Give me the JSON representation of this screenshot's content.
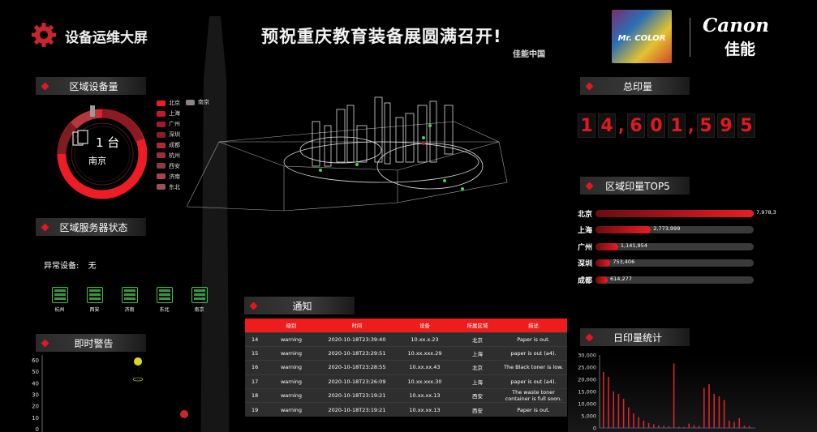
{
  "header": {
    "app_title": "设备运维大屏",
    "main_title": "预祝重庆教育装备展圆满召开!",
    "subtitle": "佳能中国",
    "brand_box_text": "Mr. COLOR",
    "brand_name": "Canon",
    "brand_name_cn": "佳能"
  },
  "region_devices": {
    "title": "区域设备量",
    "count_label": "1 台",
    "city": "南京",
    "legend": [
      {
        "name": "北京",
        "color": "#ee1c24"
      },
      {
        "name": "上海",
        "color": "#c8192a"
      },
      {
        "name": "广州",
        "color": "#a51a2b"
      },
      {
        "name": "深圳",
        "color": "#8e1c2a"
      },
      {
        "name": "成都",
        "color": "#b12a33"
      },
      {
        "name": "杭州",
        "color": "#9c2e37"
      },
      {
        "name": "西安",
        "color": "#8a3a40"
      },
      {
        "name": "济南",
        "color": "#a8444a"
      },
      {
        "name": "东北",
        "color": "#8f5558"
      }
    ],
    "legend_extra": {
      "name": "南京",
      "color": "#8d8282"
    }
  },
  "server_status": {
    "title": "区域服务器状态",
    "abnormal_label": "异常设备:",
    "abnormal_value": "无",
    "servers": [
      "杭州",
      "西安",
      "济南",
      "东北",
      "南京"
    ],
    "status_color": "#3cc24a"
  },
  "alerts": {
    "title": "即时警告",
    "y_ticks": [
      "60",
      "50",
      "40",
      "30",
      "20",
      "10",
      "0"
    ]
  },
  "total_prints": {
    "title": "总印量",
    "digits": [
      "1",
      "4",
      ",",
      "6",
      "0",
      "1",
      ",",
      "5",
      "9",
      "5"
    ]
  },
  "top5": {
    "title": "区域印量TOP5",
    "rows": [
      {
        "name": "北京",
        "value": 7978,
        "label": "7,978,3",
        "fraction": 1.0
      },
      {
        "name": "上海",
        "value": 2773999,
        "label": "2,773,999",
        "fraction": 0.35
      },
      {
        "name": "广州",
        "value": 1141954,
        "label": "1,141,954",
        "fraction": 0.143
      },
      {
        "name": "深圳",
        "value": 753406,
        "label": "753,406",
        "fraction": 0.094
      },
      {
        "name": "成都",
        "value": 614277,
        "label": "614,277",
        "fraction": 0.077
      }
    ]
  },
  "notice": {
    "title": "通知",
    "columns": [
      "级别",
      "时间",
      "设备",
      "所属区域",
      "描述"
    ],
    "rows": [
      [
        "14",
        "warning",
        "2020-10-18T23:39:40",
        "10.xx.x.23",
        "北京",
        "Paper is out."
      ],
      [
        "15",
        "warning",
        "2020-10-18T23:29:51",
        "10.xx.xxx.29",
        "上海",
        "paper is out (a4)."
      ],
      [
        "16",
        "warning",
        "2020-10-18T23:28:55",
        "10.xx.xx.43",
        "北京",
        "The Black toner is low."
      ],
      [
        "17",
        "warning",
        "2020-10-18T23:26:09",
        "10.xx.xxx.30",
        "上海",
        "paper is out (a4)."
      ],
      [
        "18",
        "warning",
        "2020-10-18T23:19:21",
        "10.xx.xx.13",
        "西安",
        "The waste toner container is full soon."
      ],
      [
        "19",
        "warning",
        "2020-10-18T23:19:21",
        "10.xx.xx.13",
        "西安",
        "Paper is out."
      ]
    ]
  },
  "daily_prints": {
    "title": "日印量统计",
    "y_ticks": [
      "30,000",
      "25,000",
      "20,000",
      "15,000",
      "10,000",
      "5,000",
      "0"
    ]
  },
  "chart_data": [
    {
      "type": "bar",
      "title": "日印量统计",
      "ylim": [
        0,
        30000
      ],
      "values": [
        23000,
        21000,
        15000,
        14000,
        12000,
        8500,
        6000,
        4500,
        3000,
        2000,
        1500,
        1000,
        900,
        700,
        26500,
        500,
        400,
        1800,
        1200,
        800,
        16500,
        18000,
        14000,
        13000,
        11500,
        3000,
        2500,
        4000,
        1000,
        800
      ]
    },
    {
      "type": "bar",
      "title": "即时警告",
      "ylim": [
        0,
        60
      ],
      "values": []
    }
  ]
}
